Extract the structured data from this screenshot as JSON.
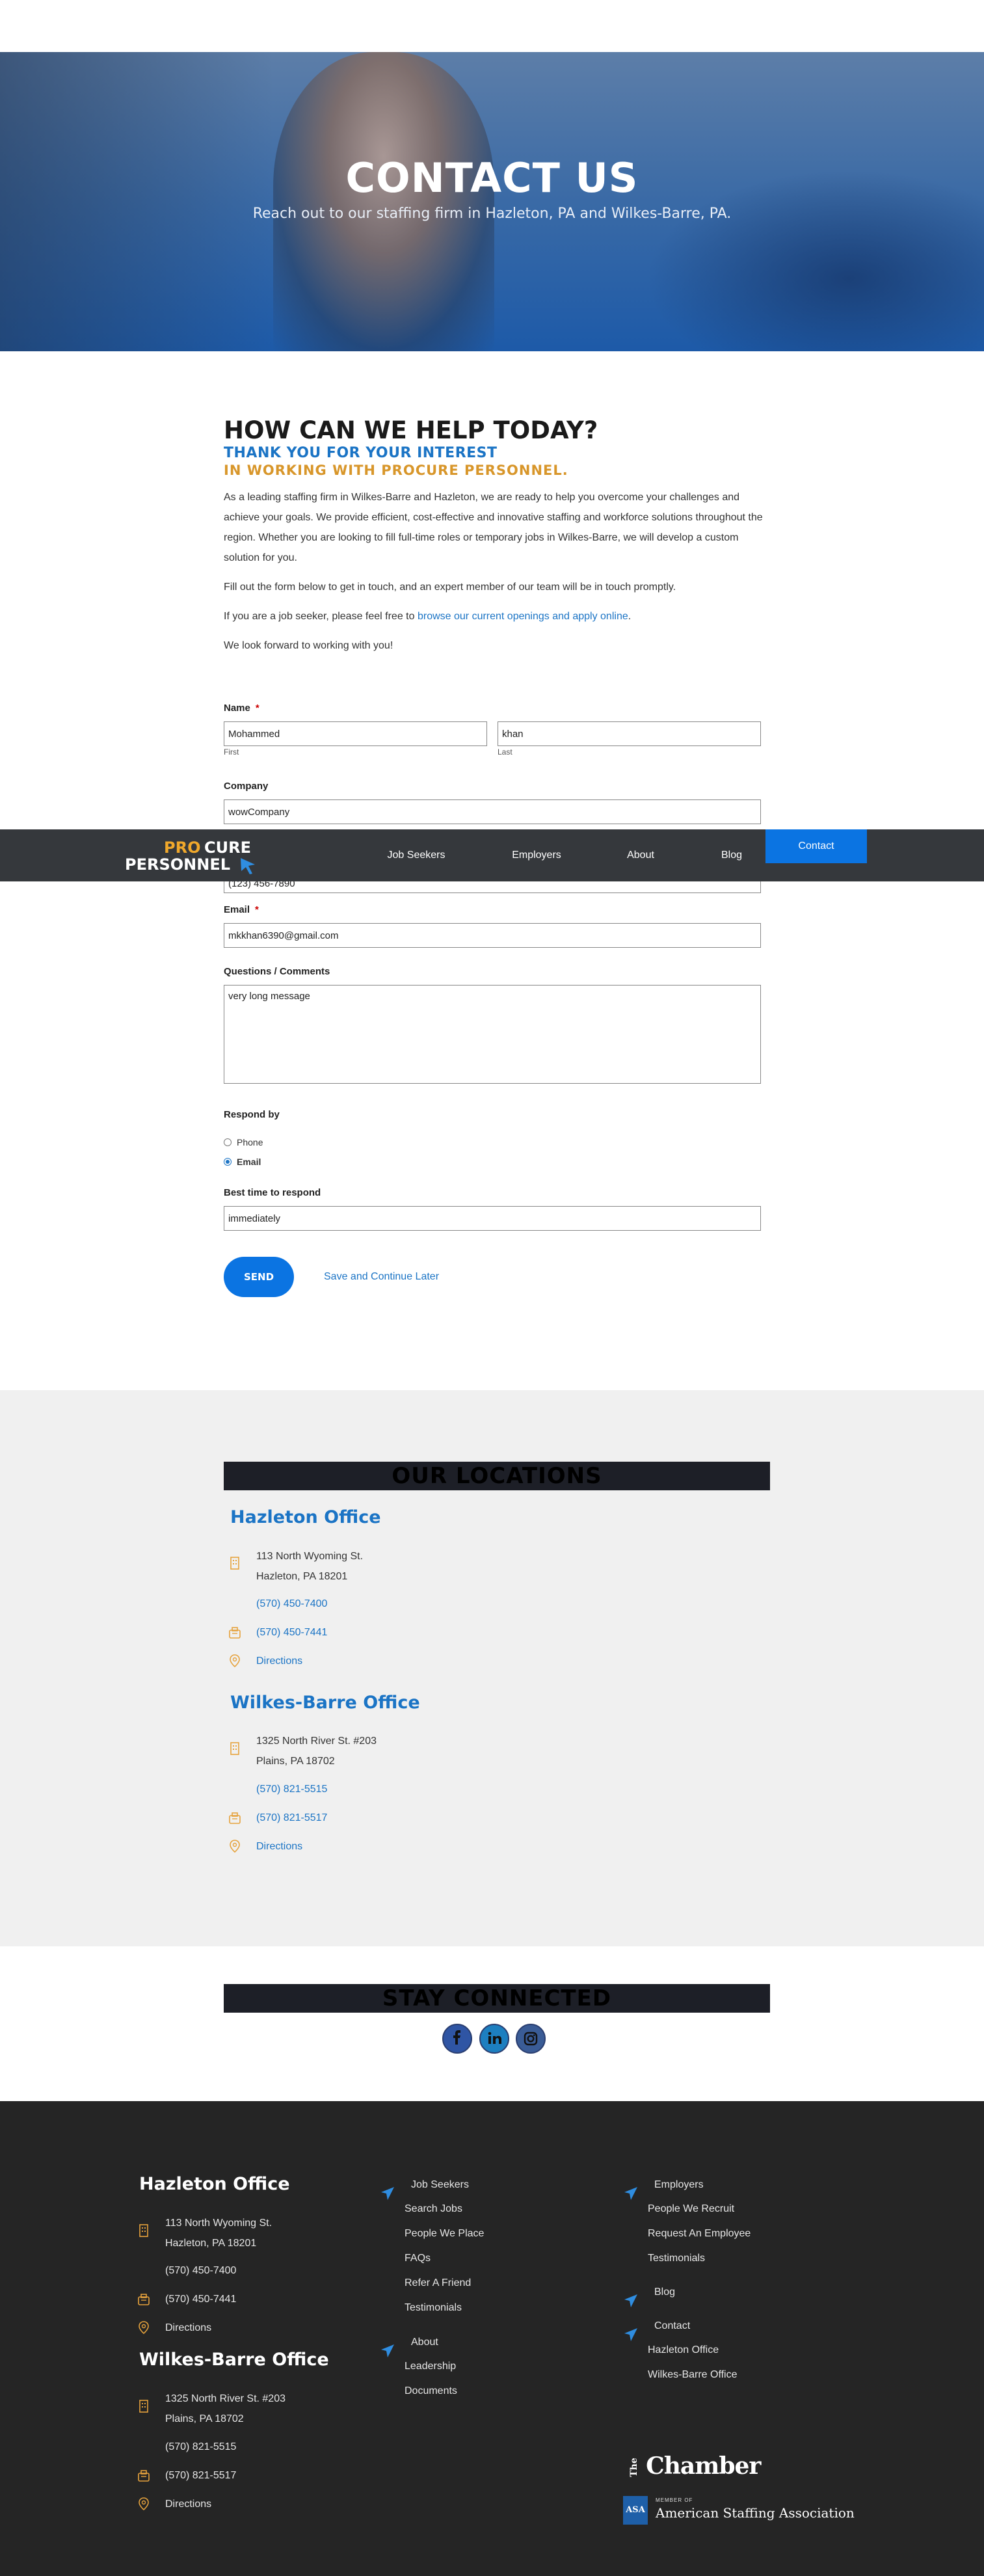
{
  "hero": {
    "title": "CONTACT US",
    "subtitle": "Reach out to our staffing firm in Hazleton, PA and Wilkes-Barre, PA."
  },
  "intro": {
    "heading": "HOW CAN WE HELP TODAY?",
    "subheading1": "THANK YOU FOR YOUR INTEREST",
    "subheading2": "IN WORKING WITH PROCURE PERSONNEL.",
    "para1": "As a leading staffing firm in Wilkes-Barre and Hazleton, we are ready to help you overcome your challenges and achieve your goals. We provide efficient, cost-effective and innovative staffing and workforce solutions throughout the region. Whether you are looking to fill full-time roles or temporary jobs in Wilkes-Barre, we will develop a custom solution for you.",
    "para2": "Fill out the form below to get in touch, and an expert member of our team will be in touch promptly.",
    "para3_prefix": "If you are a job seeker, please feel free to ",
    "para3_link": "browse our current openings and apply online",
    "para3_suffix": ".",
    "para4": "We look forward to working with you!"
  },
  "form": {
    "name_label": "Name",
    "required_mark": "*",
    "first_value": "Mohammed",
    "first_sub": "First",
    "last_value": "khan",
    "last_sub": "Last",
    "company_label": "Company",
    "company_value": "wowCompany",
    "phone_value": "(123) 456-7890",
    "email_label": "Email",
    "email_value": "mkkhan6390@gmail.com",
    "comments_label": "Questions / Comments",
    "comments_value": "very long message",
    "respond_label": "Respond by",
    "respond_options": [
      {
        "label": "Phone",
        "selected": false
      },
      {
        "label": "Email",
        "selected": true
      }
    ],
    "best_time_label": "Best time to respond",
    "best_time_value": "immediately",
    "send_label": "SEND",
    "save_later_label": "Save and Continue Later"
  },
  "nav": {
    "logo_pro": "PRO",
    "logo_cure": "CURE",
    "logo_personnel": "PERSONNEL",
    "items": [
      "Job Seekers",
      "Employers",
      "About",
      "Blog",
      "Contact"
    ]
  },
  "locations": {
    "title": "OUR LOCATIONS",
    "offices": [
      {
        "name": "Hazleton Office",
        "address1": "113 North Wyoming St.",
        "address2": "Hazleton, PA 18201",
        "phone": "(570) 450-7400",
        "fax": "(570) 450-7441",
        "directions": "Directions"
      },
      {
        "name": "Wilkes-Barre Office",
        "address1": "1325 North River St. #203",
        "address2": "Plains, PA 18702",
        "phone": "(570) 821-5515",
        "fax": "(570) 821-5517",
        "directions": "Directions"
      }
    ]
  },
  "stay_connected": {
    "title": "STAY CONNECTED",
    "icons": [
      "facebook-icon",
      "linkedin-icon",
      "instagram-icon"
    ]
  },
  "footer": {
    "col2": {
      "job_seekers": "Job Seekers",
      "job_links": [
        "Search Jobs",
        "People We Place",
        "FAQs",
        "Refer A Friend",
        "Testimonials"
      ],
      "about": "About",
      "about_links": [
        "Leadership",
        "Documents"
      ]
    },
    "col3": {
      "employers": "Employers",
      "employer_links": [
        "People We Recruit",
        "Request An Employee",
        "Testimonials"
      ],
      "blog": "Blog",
      "contact": "Contact",
      "contact_links": [
        "Hazleton Office",
        "Wilkes-Barre Office"
      ]
    },
    "chamber_the": "The",
    "chamber": "Chamber",
    "asa_badge": "ASA",
    "asa_member": "MEMBER OF",
    "asa_name": "American Staffing Association"
  },
  "colors": {
    "accent_blue": "#1b74c5",
    "button_blue": "#0b74e2",
    "gold": "#d8962a",
    "nav_bg": "#35383c",
    "footer_bg": "#252525"
  }
}
